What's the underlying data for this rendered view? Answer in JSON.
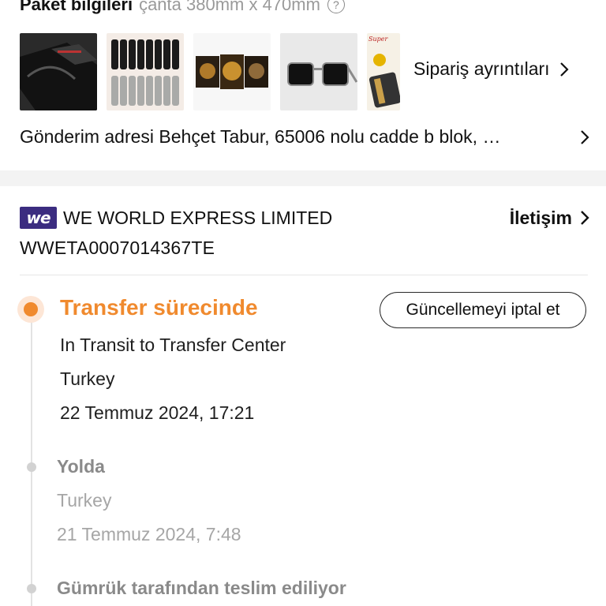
{
  "package": {
    "title": "Paket bilgileri",
    "size": "çanta 380mm x 470mm",
    "help_icon": "question-circle-icon"
  },
  "order_details": {
    "label": "Sipariş ayrıntıları",
    "icon": "chevron-right-icon"
  },
  "shipping": {
    "text": "Gönderim adresi Behçet Tabur, 65006 nolu cadde b blok, …"
  },
  "carrier": {
    "logo_text": "we",
    "logo_color": "#3b2c80",
    "name": "WE WORLD EXPRESS LIMITED",
    "contact_label": "İletişim",
    "tracking_number": "WWETA0007014367TE"
  },
  "events": [
    {
      "status": "Transfer sürecinde",
      "detail": "In Transit to Transfer Center",
      "location": "Turkey",
      "time": "22 Temmuz 2024, 17:21",
      "active": true
    },
    {
      "status": "Yolda",
      "location": "Turkey",
      "time": "21 Temmuz 2024, 7:48",
      "active": false
    },
    {
      "status": "Gümrük tarafından teslim ediliyor",
      "active": false
    }
  ],
  "cancel_button": {
    "label": "Güncellemeyi iptal et"
  },
  "colors": {
    "accent": "#f08a2e",
    "accent_soft": "#fde6d6",
    "muted_text": "#a6a6a6",
    "section_gap": "#f3f3f3"
  }
}
